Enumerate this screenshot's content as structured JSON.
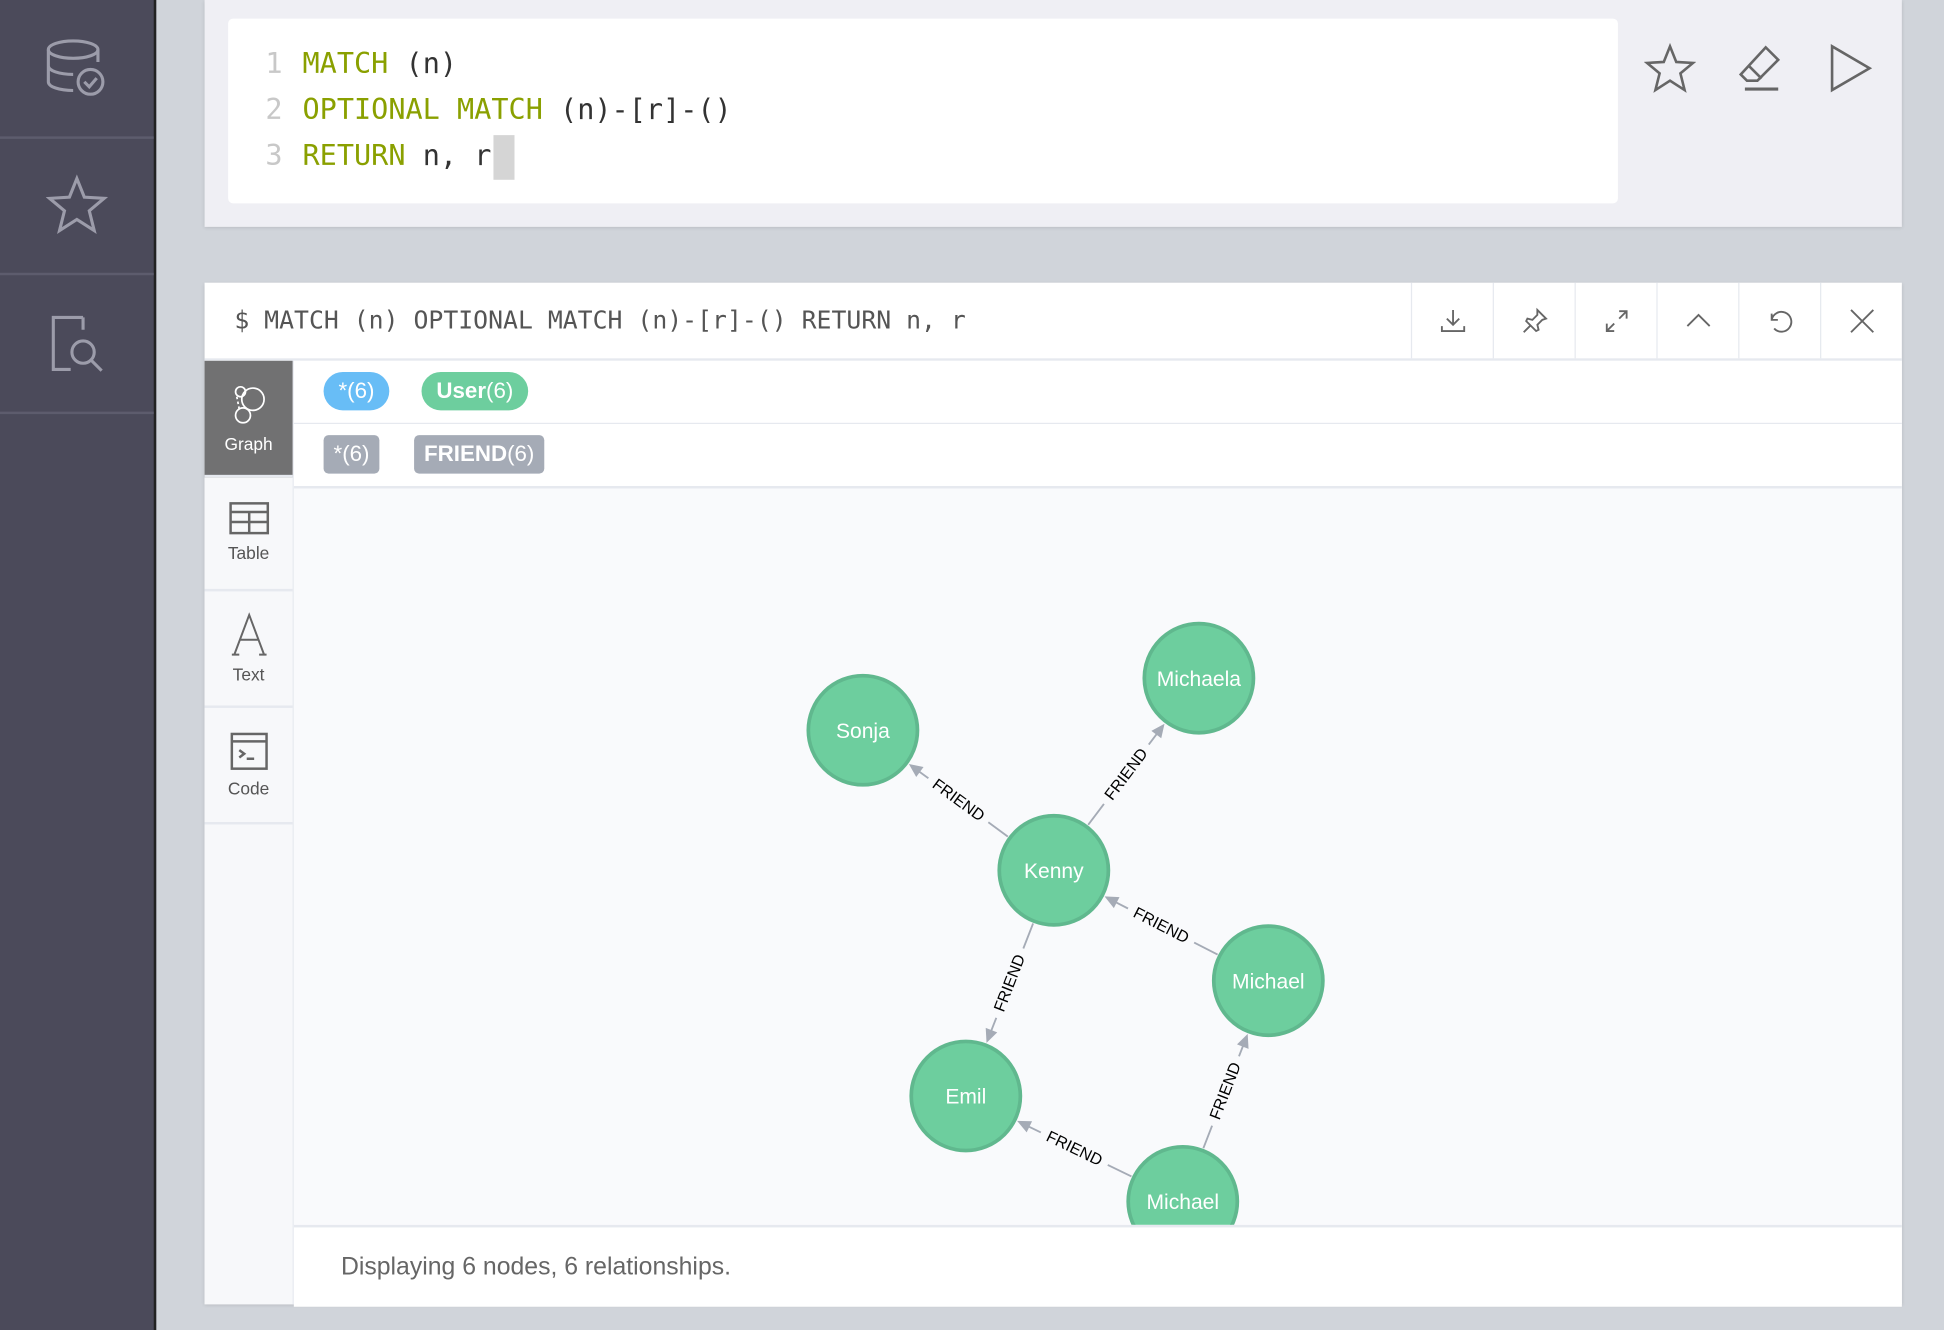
{
  "editor": {
    "lines": [
      {
        "num": "1",
        "keyword": "MATCH",
        "rest": " (n)"
      },
      {
        "num": "2",
        "keyword": "OPTIONAL MATCH",
        "rest": " (n)-[r]-()"
      },
      {
        "num": "3",
        "keyword": "RETURN",
        "rest": " n, r"
      }
    ],
    "buttons": [
      "star-icon",
      "eraser-icon",
      "play-icon"
    ]
  },
  "nav": {
    "icons": [
      "database-check-icon",
      "star-icon",
      "document-search-icon"
    ]
  },
  "result": {
    "command": "$ MATCH (n) OPTIONAL MATCH (n)-[r]-() RETURN n, r",
    "header_buttons": [
      "download-icon",
      "pin-icon",
      "expand-icon",
      "collapse-icon",
      "refresh-icon",
      "close-icon"
    ],
    "views": [
      {
        "label": "Graph",
        "icon": "graph-icon",
        "active": true
      },
      {
        "label": "Table",
        "icon": "table-icon",
        "active": false
      },
      {
        "label": "Text",
        "icon": "text-icon",
        "active": false
      },
      {
        "label": "Code",
        "icon": "code-icon",
        "active": false
      }
    ],
    "node_labels": [
      {
        "name": "*",
        "count": "(6)",
        "color": "#68bdf6"
      },
      {
        "name": "User",
        "count": "(6)",
        "color": "#6dce9e"
      }
    ],
    "rel_types": [
      {
        "name": "*",
        "count": "(6)",
        "color": "#a5abb6"
      },
      {
        "name": "FRIEND",
        "count": "(6)",
        "color": "#a5abb6"
      }
    ],
    "status": "Displaying 6 nodes, 6 relationships."
  },
  "graph": {
    "node_color": "#6dce9e",
    "node_border": "#60b88e",
    "edge_color": "#a5abb6",
    "nodes": [
      {
        "id": "sonja",
        "name": "Sonja"
      },
      {
        "id": "michaela",
        "name": "Michaela"
      },
      {
        "id": "kenny",
        "name": "Kenny"
      },
      {
        "id": "michael1",
        "name": "Michael"
      },
      {
        "id": "emil",
        "name": "Emil"
      },
      {
        "id": "michael2",
        "name": "Michael"
      }
    ],
    "relationships": [
      {
        "from": "kenny",
        "to": "sonja",
        "type": "FRIEND"
      },
      {
        "from": "kenny",
        "to": "michaela",
        "type": "FRIEND"
      },
      {
        "from": "michael1",
        "to": "kenny",
        "type": "FRIEND"
      },
      {
        "from": "kenny",
        "to": "emil",
        "type": "FRIEND"
      },
      {
        "from": "michael2",
        "to": "michael1",
        "type": "FRIEND"
      },
      {
        "from": "michael2",
        "to": "emil",
        "type": "FRIEND"
      }
    ]
  }
}
